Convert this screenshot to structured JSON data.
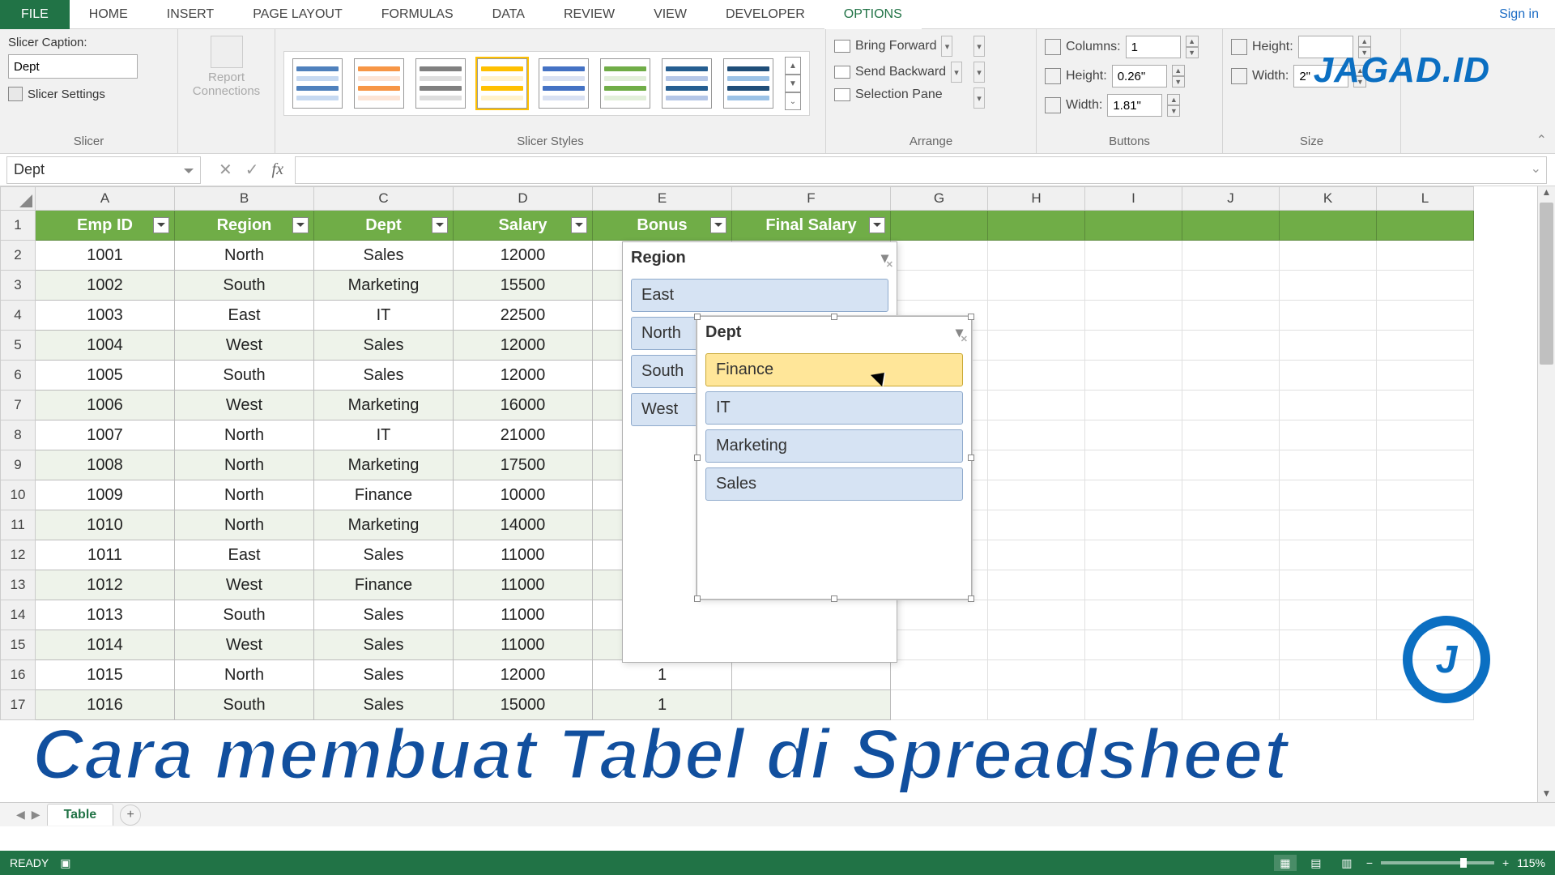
{
  "ribbon": {
    "tabs": [
      "FILE",
      "HOME",
      "INSERT",
      "PAGE LAYOUT",
      "FORMULAS",
      "DATA",
      "REVIEW",
      "VIEW",
      "DEVELOPER",
      "OPTIONS"
    ],
    "active_tab": "OPTIONS",
    "signin": "Sign in",
    "groups": {
      "slicer": {
        "label": "Slicer",
        "caption_label": "Slicer Caption:",
        "caption_value": "Dept",
        "settings": "Slicer Settings",
        "report_conn": "Report Connections"
      },
      "styles": {
        "label": "Slicer Styles"
      },
      "arrange": {
        "label": "Arrange",
        "bring_forward": "Bring Forward",
        "send_backward": "Send Backward",
        "selection_pane": "Selection Pane"
      },
      "buttons": {
        "label": "Buttons",
        "columns_label": "Columns:",
        "columns_value": "1",
        "height_label": "Height:",
        "height_value": "0.26\"",
        "width_label": "Width:",
        "width_value": "1.81\""
      },
      "size": {
        "label": "Size",
        "height_label": "Height:",
        "width_label": "Width:",
        "width_value": "2\""
      }
    }
  },
  "name_box": "Dept",
  "columns": [
    "A",
    "B",
    "C",
    "D",
    "E",
    "F",
    "G",
    "H",
    "I",
    "J",
    "K",
    "L"
  ],
  "table": {
    "headers": [
      "Emp ID",
      "Region",
      "Dept",
      "Salary",
      "Bonus",
      "Final Salary"
    ],
    "rows": [
      {
        "r": "1001",
        "reg": "North",
        "dept": "Sales",
        "sal": "12000"
      },
      {
        "r": "1002",
        "reg": "South",
        "dept": "Marketing",
        "sal": "15500"
      },
      {
        "r": "1003",
        "reg": "East",
        "dept": "IT",
        "sal": "22500"
      },
      {
        "r": "1004",
        "reg": "West",
        "dept": "Sales",
        "sal": "12000"
      },
      {
        "r": "1005",
        "reg": "South",
        "dept": "Sales",
        "sal": "12000"
      },
      {
        "r": "1006",
        "reg": "West",
        "dept": "Marketing",
        "sal": "16000"
      },
      {
        "r": "1007",
        "reg": "North",
        "dept": "IT",
        "sal": "21000"
      },
      {
        "r": "1008",
        "reg": "North",
        "dept": "Marketing",
        "sal": "17500"
      },
      {
        "r": "1009",
        "reg": "North",
        "dept": "Finance",
        "sal": "10000"
      },
      {
        "r": "1010",
        "reg": "North",
        "dept": "Marketing",
        "sal": "14000"
      },
      {
        "r": "1011",
        "reg": "East",
        "dept": "Sales",
        "sal": "11000"
      },
      {
        "r": "1012",
        "reg": "West",
        "dept": "Finance",
        "sal": "11000"
      },
      {
        "r": "1013",
        "reg": "South",
        "dept": "Sales",
        "sal": "11000"
      },
      {
        "r": "1014",
        "reg": "West",
        "dept": "Sales",
        "sal": "11000"
      },
      {
        "r": "1015",
        "reg": "North",
        "dept": "Sales",
        "sal": "12000",
        "e": "1"
      },
      {
        "r": "1016",
        "reg": "South",
        "dept": "Sales",
        "sal": "15000",
        "e": "1"
      }
    ]
  },
  "slicers": {
    "region": {
      "title": "Region",
      "items": [
        "East",
        "North",
        "South",
        "West"
      ]
    },
    "dept": {
      "title": "Dept",
      "items": [
        "Finance",
        "IT",
        "Marketing",
        "Sales"
      ],
      "selected": "Finance"
    }
  },
  "sheet_tab": "Table",
  "status": {
    "ready": "READY",
    "zoom": "115%"
  },
  "watermark": {
    "logo": "JAGAD.ID",
    "caption": "Cara membuat Tabel di Spreadsheet"
  }
}
